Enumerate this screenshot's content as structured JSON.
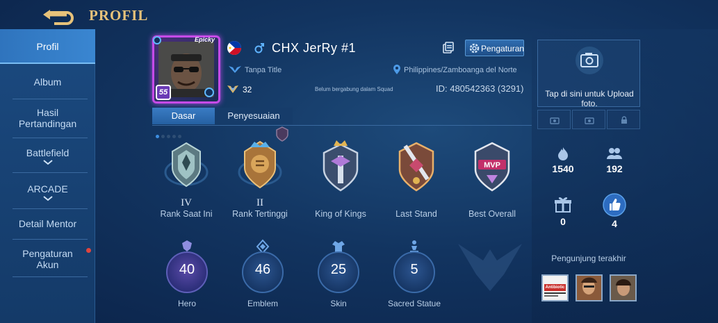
{
  "header": {
    "title": "PROFIL",
    "back_icon": "back-arrow-icon"
  },
  "sidebar": {
    "items": [
      {
        "label": "Profil",
        "active": true
      },
      {
        "label": "Album"
      },
      {
        "label": "Hasil Pertandingan"
      },
      {
        "label": "Battlefield",
        "has_chevron": true
      },
      {
        "label": "ARCADE",
        "has_chevron": true
      },
      {
        "label": "Detail Mentor"
      },
      {
        "label": "Pengaturan Akun",
        "has_notification": true
      }
    ]
  },
  "profile": {
    "frame_text": "Epicky",
    "frame_level": "55",
    "name": "CHX JerRy #1",
    "gender": "male",
    "flag": "Philippines",
    "title": "Tanpa Title",
    "location": "Philippines/Zamboanga del Norte",
    "level": "32",
    "squad": "Belum bergabung dalam Squad",
    "id": "ID: 480542363 (3291)"
  },
  "actions": {
    "settings_label": "Pengaturan"
  },
  "tabs": [
    {
      "label": "Dasar",
      "active": true
    },
    {
      "label": "Penyesuaian"
    }
  ],
  "badges": [
    {
      "roman": "IV",
      "label": "Rank Saat Ini"
    },
    {
      "roman": "II",
      "label": "Rank Tertinggi"
    },
    {
      "roman": "",
      "label": "King of Kings"
    },
    {
      "roman": "",
      "label": "Last Stand"
    },
    {
      "roman": "",
      "label": "Best Overall"
    }
  ],
  "stats": [
    {
      "value": "40",
      "label": "Hero"
    },
    {
      "value": "46",
      "label": "Emblem"
    },
    {
      "value": "25",
      "label": "Skin"
    },
    {
      "value": "5",
      "label": "Sacred Statue"
    }
  ],
  "right": {
    "upload_text": "Tap di sini untuk Upload foto.",
    "popularity": "1540",
    "followers": "192",
    "gifts": "0",
    "likes": "4",
    "visitors_label": "Pengunjung terakhir",
    "visitor_1_text": "Antibiotic"
  },
  "colors": {
    "accent_gold": "#e7c27a",
    "active_blue": "#3a86d1",
    "notify_red": "#e0453e"
  }
}
